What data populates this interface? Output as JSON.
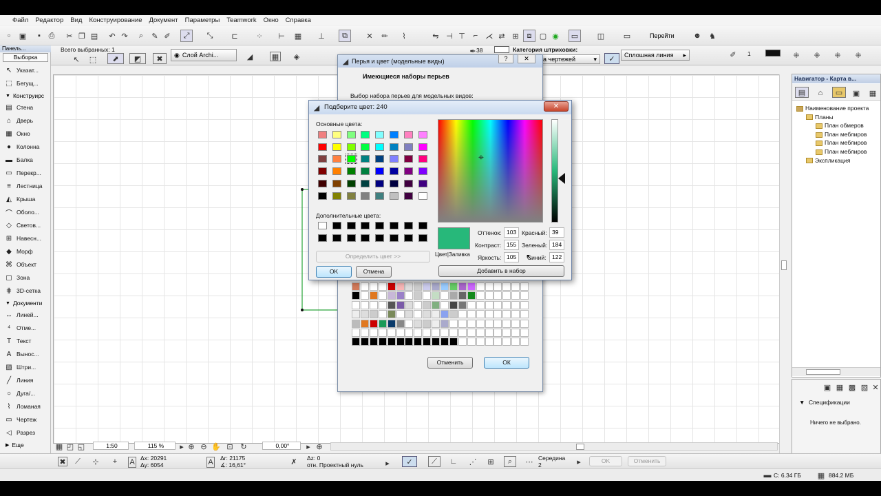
{
  "menu": [
    "Файл",
    "Редактор",
    "Вид",
    "Конструирование",
    "Документ",
    "Параметры",
    "Teamwork",
    "Окно",
    "Справка"
  ],
  "toolbar": {
    "goto_label": "Перейти"
  },
  "infobox": {
    "selected_label": "Всего выбранных: 1",
    "layer_label": "Слой Archi...",
    "pen_number": "38",
    "hatch_category_label": "Категория штриховки:",
    "hatch_category_value": "а чертежей",
    "line_type": "Сплошная линия",
    "pen_count": "1"
  },
  "left_palette": {
    "title": "Панель...",
    "tab": "Выборка",
    "select_tools": [
      "Указат...",
      "Бегущ..."
    ],
    "section_design": "Конструирс",
    "design_tools": [
      "Стена",
      "Дверь",
      "Окно",
      "Колонна",
      "Балка",
      "Перекр...",
      "Лестница",
      "Крыша",
      "Оболо...",
      "Светов...",
      "Навесн...",
      "Морф",
      "Объект",
      "Зона",
      "3D-сетка"
    ],
    "section_document": "Документи",
    "document_tools": [
      "Линей...",
      "Отме...",
      "Текст",
      "Вынос...",
      "Штри...",
      "Линия",
      "Дуга/...",
      "Ломаная",
      "Чертеж",
      "Разрез"
    ],
    "more_label": "Еще"
  },
  "navigator": {
    "title": "Навигатор - Карта в...",
    "tree": [
      {
        "label": "Наименование проекта",
        "level": 0
      },
      {
        "label": "Планы",
        "level": 1
      },
      {
        "label": "План обмеров",
        "level": 2
      },
      {
        "label": "План меблиров",
        "level": 2
      },
      {
        "label": "План меблиров",
        "level": 2
      },
      {
        "label": "План меблиров",
        "level": 2
      },
      {
        "label": "Экспликация",
        "level": 1
      }
    ],
    "props_section": "Спецификации",
    "props_empty": "Ничего не выбрано."
  },
  "pen_dialog": {
    "title": "Перья и цвет (модельные виды)",
    "heading": "Имеющиеся наборы перьев",
    "subheading": "Выбор набора перьев для модельных видов:",
    "cancel_label": "Отменить",
    "ok_label": "ОК"
  },
  "color_dialog": {
    "title": "Подберите цвет: 240",
    "basic_colors_label": "Основные цвета:",
    "basic_colors": [
      "#f08080",
      "#ffff80",
      "#80ff80",
      "#00ff80",
      "#80ffff",
      "#0080ff",
      "#ff80c0",
      "#ff80ff",
      "#ff0000",
      "#ffff00",
      "#80ff00",
      "#00ff40",
      "#00ffff",
      "#0080c0",
      "#8080c0",
      "#ff00ff",
      "#804040",
      "#ff8040",
      "#00ff00",
      "#008080",
      "#004080",
      "#8080ff",
      "#800040",
      "#ff0080",
      "#800000",
      "#ff8000",
      "#008000",
      "#008040",
      "#0000ff",
      "#0000a0",
      "#800080",
      "#8000ff",
      "#400000",
      "#804000",
      "#004000",
      "#004040",
      "#000080",
      "#000040",
      "#400040",
      "#400080",
      "#000000",
      "#808000",
      "#808040",
      "#808080",
      "#408080",
      "#c0c0c0",
      "#400040",
      "#ffffff"
    ],
    "custom_colors_label": "Дополнительные цвета:",
    "custom_colors": [
      "#ffffff",
      "#000000",
      "#000000",
      "#000000",
      "#000000",
      "#000000",
      "#000000",
      "#000000",
      "#000000",
      "#000000",
      "#000000",
      "#000000",
      "#000000",
      "#000000",
      "#000000",
      "#000000"
    ],
    "define_label": "Определить цвет >>",
    "ok_label": "OK",
    "cancel_label": "Отмена",
    "preview_color": "#27b87a",
    "preview_label": "Цвет|Заливка",
    "hue_label": "Оттенок:",
    "hue": "103",
    "sat_label": "Контраст:",
    "sat": "155",
    "lum_label": "Яркость:",
    "lum": "105",
    "red_label": "Красный:",
    "red": "39",
    "green_label": "Зеленый:",
    "green": "184",
    "blue_label": "Синий:",
    "blue": "122",
    "add_label": "Добавить в набор"
  },
  "bottom": {
    "scale": "1:50",
    "zoom": "115 %",
    "angle": "0,00°",
    "dx": "Δx: 20291",
    "dy": "Δy: 6054",
    "dr": "Δr: 21175",
    "da": "∡: 16,61°",
    "dz": "Δz: 0",
    "ref": "отн. Проектный нуль",
    "snap_label": "Середина",
    "snap_count": "2",
    "ok_label": "OK",
    "cancel_label": "Отменить"
  },
  "status": {
    "disk": "C: 6.34 ГБ",
    "mem": "884.2 МБ"
  }
}
